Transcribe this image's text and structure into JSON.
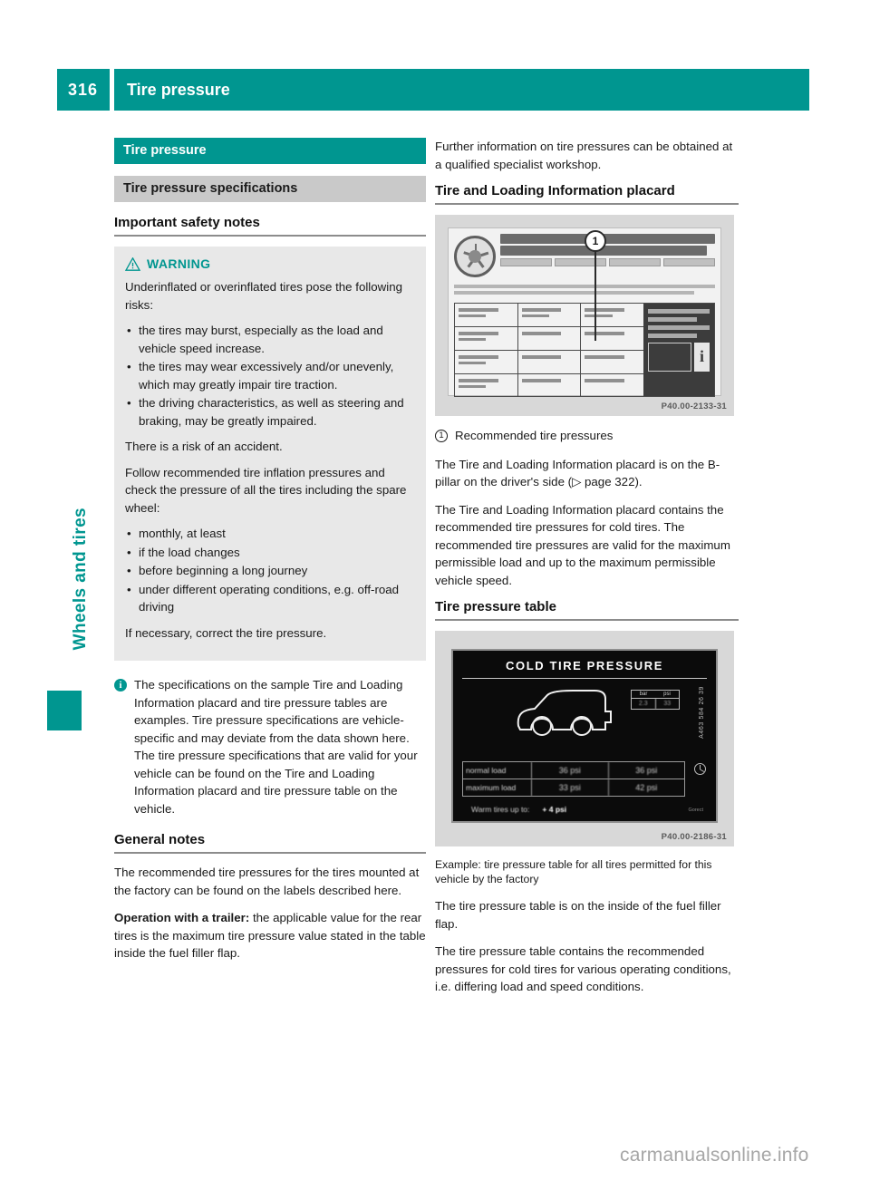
{
  "header": {
    "page_number": "316",
    "title": "Tire pressure",
    "accent_color": "#009690"
  },
  "chapter_tab": {
    "label": "Wheels and tires"
  },
  "left_column": {
    "section_bar": "Tire pressure",
    "subsection_bar": "Tire pressure specifications",
    "heading_safety": "Important safety notes",
    "warning": {
      "label": "WARNING",
      "intro": "Underinflated or overinflated tires pose the following risks:",
      "risks": [
        "the tires may burst, especially as the load and vehicle speed increase.",
        "the tires may wear excessively and/or unevenly, which may greatly impair tire traction.",
        "the driving characteristics, as well as steering and braking, may be greatly impaired."
      ],
      "risk_statement": "There is a risk of an accident.",
      "follow_intro": "Follow recommended tire inflation pressures and check the pressure of all the tires including the spare wheel:",
      "check_items": [
        "monthly, at least",
        "if the load changes",
        "before beginning a long journey",
        "under different operating conditions, e.g. off-road driving"
      ],
      "closing": "If necessary, correct the tire pressure."
    },
    "info_note": {
      "icon": "info-icon",
      "text": "The specifications on the sample Tire and Loading Information placard and tire pressure tables are examples. Tire pressure specifications are vehicle-specific and may deviate from the data shown here. The tire pressure specifications that are valid for your vehicle can be found on the Tire and Loading Information placard and tire pressure table on the vehicle."
    },
    "heading_general": "General notes",
    "general_paragraph": "The recommended tire pressures for the tires mounted at the factory can be found on the labels described here.",
    "trailer_label": "Operation with a trailer:",
    "trailer_text": " the applicable value for the rear tires is the maximum tire pressure value stated in the table inside the fuel filler flap."
  },
  "right_column": {
    "intro_paragraph": "Further information on tire pressures can be obtained at a qualified specialist workshop.",
    "heading_placard": "Tire and Loading Information placard",
    "placard_figure": {
      "code": "P40.00-2133-31",
      "marker": "1"
    },
    "callout": {
      "number": "1",
      "text": "Recommended tire pressures"
    },
    "placard_location": "The Tire and Loading Information placard is on the B-pillar on the driver's side (▷ page 322).",
    "placard_contents": "The Tire and Loading Information placard contains the recommended tire pressures for cold tires. The recommended tire pressures are valid for the maximum permissible load and up to the maximum permissible vehicle speed.",
    "heading_table": "Tire pressure table",
    "table_figure": {
      "code": "P40.00-2186-31",
      "title": "COLD TIRE PRESSURE",
      "units": [
        "bar",
        "psi"
      ],
      "unit_values": [
        "2.3",
        "33"
      ],
      "rows": [
        {
          "label": "normal load",
          "front": "36 psi",
          "rear": "36 psi"
        },
        {
          "label": "maximum load",
          "front": "33 psi",
          "rear": "42 psi"
        }
      ],
      "footnote_label": "Warm tires up to:",
      "footnote_value": "+ 4 psi",
      "side_code": "A463 584 26 39",
      "credit": "Gorect"
    },
    "table_caption": "Example: tire pressure table for all tires permitted for this vehicle by the factory",
    "table_location": "The tire pressure table is on the inside of the fuel filler flap.",
    "table_contents": "The tire pressure table contains the recommended pressures for cold tires for various operating conditions, i.e. differing load and speed conditions."
  },
  "watermark": "carmanualsonline.info"
}
